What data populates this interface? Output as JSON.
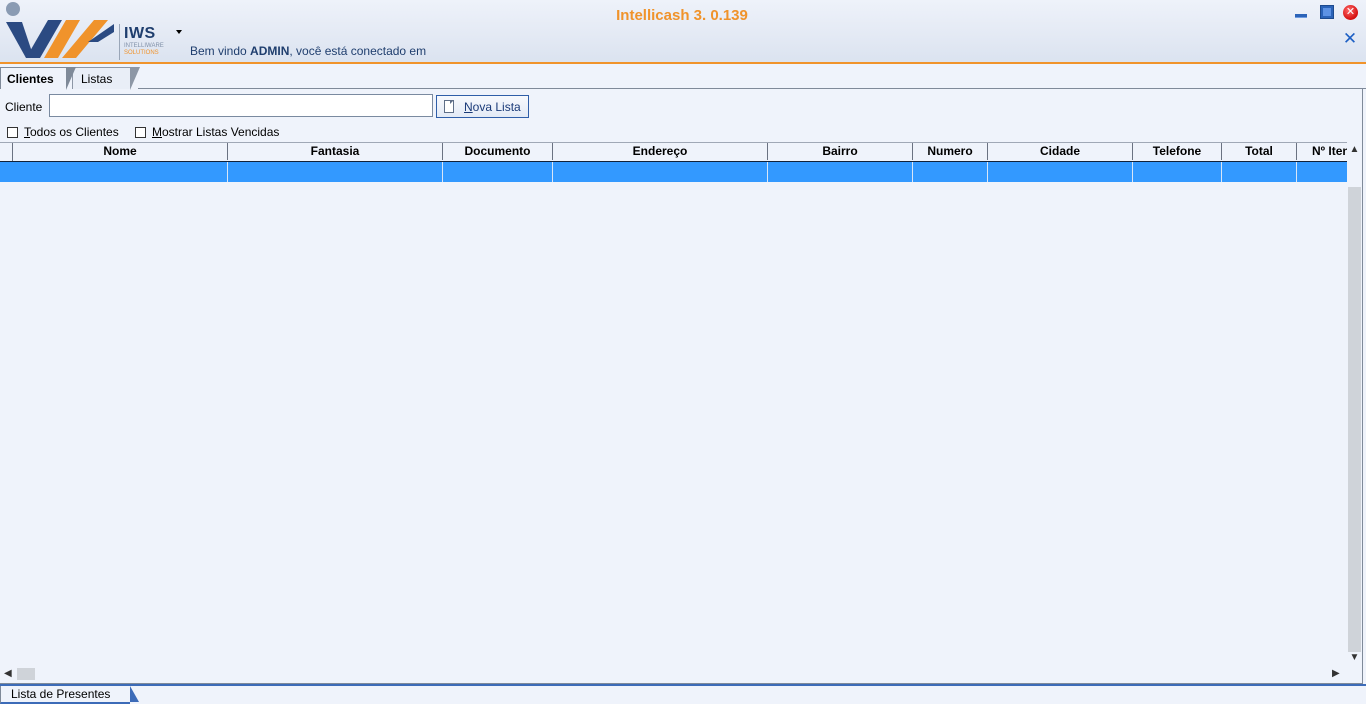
{
  "header": {
    "logo_brand": "IWS",
    "logo_sub1": "INTELLIWARE",
    "logo_sub2": "SOLUTIONS",
    "app_title": "Intellicash 3. 0.139",
    "welcome_prefix": "Bem vindo ",
    "welcome_user": "ADMIN",
    "welcome_suffix": ", você está conectado em",
    "close_glyph": "✕"
  },
  "tabs": [
    {
      "label": "Clientes",
      "active": true
    },
    {
      "label": "Listas",
      "active": false
    }
  ],
  "search": {
    "label": "Cliente",
    "value": "",
    "placeholder": ""
  },
  "toolbar": {
    "nova_lista_key": "N",
    "nova_lista_rest": "ova Lista"
  },
  "filters": {
    "todos_key": "T",
    "todos_rest": "odos os Clientes",
    "todos_checked": false,
    "vencidas_key": "M",
    "vencidas_rest": "ostrar Listas Vencidas",
    "vencidas_checked": false
  },
  "grid": {
    "columns": [
      "Nome",
      "Fantasia",
      "Documento",
      "Endereço",
      "Bairro",
      "Numero",
      "Cidade",
      "Telefone",
      "Total",
      "Nº Itens"
    ],
    "rows": [
      [
        "",
        "",
        "",
        "",
        "",
        "",
        "",
        "",
        "",
        ""
      ]
    ]
  },
  "bottom_tab": {
    "label": "Lista de Presentes"
  },
  "colors": {
    "accent": "#f0932b",
    "selection": "#3399ff",
    "brand_blue": "#1f3e6e"
  }
}
